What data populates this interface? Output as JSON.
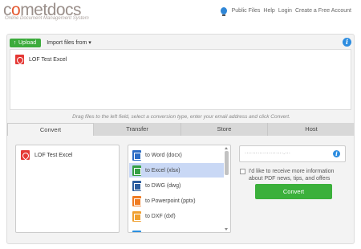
{
  "header": {
    "logo_prefix": "c",
    "logo_o": "o",
    "logo_rest": "metdocs",
    "tagline": "Online Document Management System",
    "nav": [
      "Public Files",
      "Help",
      "Login",
      "Create a Free Account"
    ]
  },
  "upload_bar": {
    "upload_label": "Upload",
    "upload_arrow": "↑",
    "import_label": "Import files from ▾",
    "info_glyph": "i"
  },
  "dropzone": {
    "files": [
      {
        "name": "LOF Test Excel"
      }
    ]
  },
  "hint": "Drag files to the left field, select a conversion type, enter your email address and click Convert.",
  "tabs": [
    "Convert",
    "Transfer",
    "Store",
    "Host"
  ],
  "active_tab": "Convert",
  "convert": {
    "selected_files": [
      {
        "name": "LOF Test Excel"
      }
    ],
    "conversion_types": [
      {
        "label": "to Word (docx)",
        "icon": "word-icon"
      },
      {
        "label": "to Excel (xlsx)",
        "icon": "excel-icon",
        "selected": true
      },
      {
        "label": "to DWG (dwg)",
        "icon": "dwg-icon"
      },
      {
        "label": "to Powerpoint (pptx)",
        "icon": "powerpoint-icon"
      },
      {
        "label": "to DXF (dxf)",
        "icon": "dxf-icon"
      }
    ],
    "email_value": "·····················.···",
    "email_info_glyph": "i",
    "optin_label": "I'd like to receive more information about PDF news, tips, and offers",
    "optin_checked": false,
    "convert_label": "Convert"
  }
}
